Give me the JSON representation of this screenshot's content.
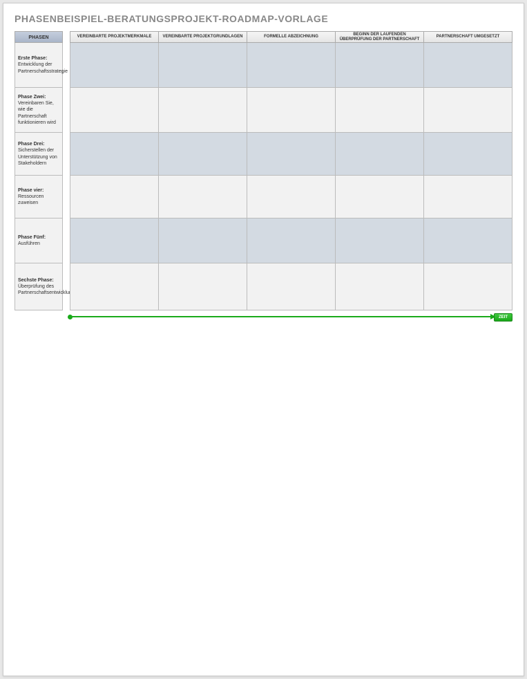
{
  "title": "PHASENBEISPIEL-BERATUNGSPROJEKT-ROADMAP-VORLAGE",
  "phaseHeader": "PHASEN",
  "phases": [
    {
      "name": "Erste Phase:",
      "desc": "Entwicklung der Partnerschaftsstrategie"
    },
    {
      "name": "Phase Zwei:",
      "desc": "Vereinbaren Sie, wie die Partnerschaft funktionieren wird"
    },
    {
      "name": "Phase Drei:",
      "desc": "Sicherstellen der Unterstützung von Stakeholdern"
    },
    {
      "name": "Phase vier:",
      "desc": "Ressourcen zuweisen"
    },
    {
      "name": "Phase Fünf:",
      "desc": "Ausführen"
    },
    {
      "name": "Sechste Phase:",
      "desc": "Überprüfung des Partnerschaftsentwicklungsprozesses"
    }
  ],
  "columns": [
    "VEREINBARTE PROJEKTMERKMALE",
    "VEREINBARTE PROJEKTGRUNDLAGEN",
    "FORMELLE ABZEICHNUNG",
    "BEGINN DER LAUFENDEN ÜBERPRÜFUNG DER PARTNERSCHAFT",
    "PARTNERSCHAFT UMGESETZT"
  ],
  "timelineLabel": "ZEIT"
}
